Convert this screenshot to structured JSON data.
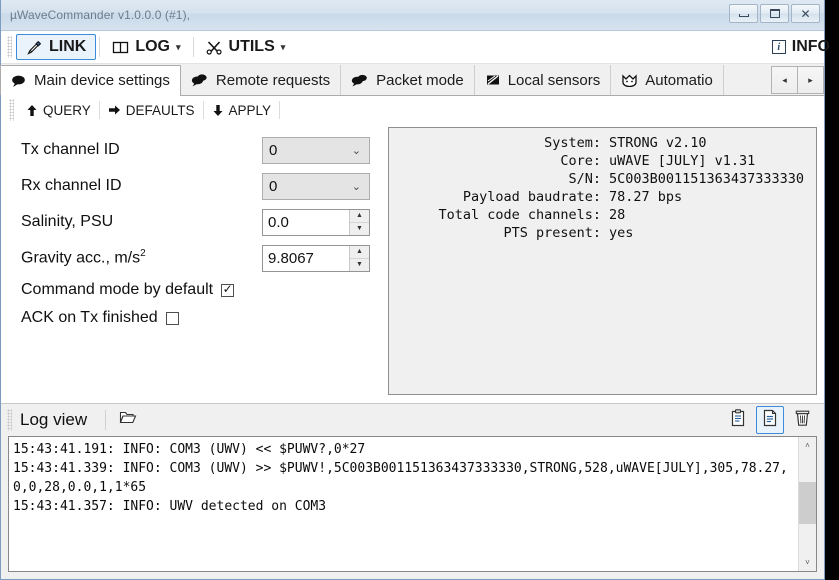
{
  "window": {
    "title": "µWaveCommander v1.0.0.0 (#1),",
    "minimize_label": "minimize",
    "maximize_label": "maximize",
    "close_label": "✕"
  },
  "commandbar": {
    "items": [
      {
        "label": "LINK",
        "icon": "plug-icon",
        "active": true,
        "has_caret": false
      },
      {
        "label": "LOG",
        "icon": "book-icon",
        "active": false,
        "has_caret": true
      },
      {
        "label": "UTILS",
        "icon": "tools-icon",
        "active": false,
        "has_caret": true
      }
    ],
    "info_label": "INFO",
    "info_icon": "info-icon",
    "info_glyph": "i",
    "caret": "▾"
  },
  "tabs": {
    "items": [
      {
        "label": "Main device settings",
        "icon": "speech-bubble-icon",
        "selected": true
      },
      {
        "label": "Remote requests",
        "icon": "speech-bubbles-icon",
        "selected": false
      },
      {
        "label": "Packet mode",
        "icon": "speech-bubbles-icon",
        "selected": false
      },
      {
        "label": "Local sensors",
        "icon": "sensor-icon",
        "selected": false
      },
      {
        "label": "Automatio",
        "icon": "crown-icon",
        "selected": false
      }
    ],
    "nav_prev": "◂",
    "nav_next": "▸"
  },
  "toolbar": {
    "query_label": "QUERY",
    "query_icon": "arrow-up-icon",
    "defaults_label": "DEFAULTS",
    "defaults_icon": "arrow-right-icon",
    "apply_label": "APPLY",
    "apply_icon": "arrow-down-icon"
  },
  "form": {
    "fields": [
      {
        "label": "Tx channel ID",
        "type": "combo",
        "value": "0"
      },
      {
        "label": "Rx channel ID",
        "type": "combo",
        "value": "0"
      },
      {
        "label": "Salinity, PSU",
        "type": "spin",
        "value": "0.0"
      },
      {
        "label": "Gravity acc., m/s",
        "label_sup": "2",
        "type": "spin",
        "value": "9.8067"
      }
    ],
    "checkboxes": [
      {
        "label": "Command mode by default",
        "checked": true,
        "mark": "✓"
      },
      {
        "label": "ACK on Tx finished",
        "checked": false,
        "mark": ""
      }
    ],
    "chevron": "⌄",
    "spin_up": "▲",
    "spin_down": "▼"
  },
  "device_info": {
    "lines": [
      {
        "key": "System:",
        "value": "STRONG v2.10"
      },
      {
        "key": "Core:",
        "value": "uWAVE [JULY] v1.31"
      },
      {
        "key": "S/N:",
        "value": "5C003B001151363437333330"
      },
      {
        "key": "Payload baudrate:",
        "value": "78.27 bps"
      },
      {
        "key": "Total code channels:",
        "value": "28"
      },
      {
        "key": "PTS present:",
        "value": "yes"
      }
    ]
  },
  "logview": {
    "title": "Log view",
    "folder_icon": "folder-icon",
    "icons": [
      {
        "name": "clipboard-icon",
        "active": false
      },
      {
        "name": "document-icon",
        "active": true
      },
      {
        "name": "trash-icon",
        "active": false
      }
    ],
    "scroll_up": "˄",
    "scroll_down": "˅",
    "lines": [
      "15:43:41.191: INFO: COM3 (UWV) << $PUWV?,0*27",
      "15:43:41.339: INFO: COM3 (UWV) >> $PUWV!,5C003B001151363437333330,STRONG,528,uWAVE[JULY],305,78.27,0,0,28,0.0,1,1*65",
      "15:43:41.357: INFO: UWV detected on COM3"
    ]
  },
  "colors": {
    "accent": "#3c8cdc",
    "titlebar": "#d4e1ee",
    "panel": "#f0f0f0"
  }
}
